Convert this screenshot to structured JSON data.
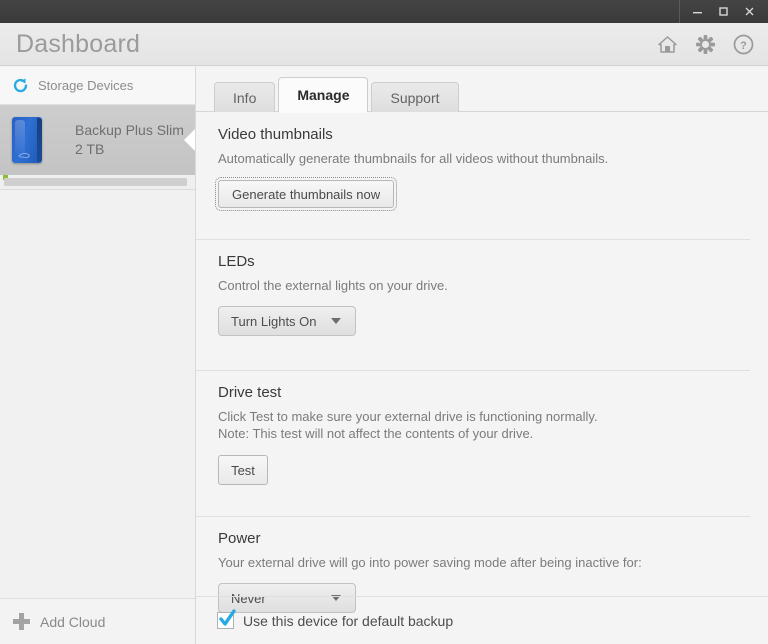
{
  "window": {
    "minimize_label": "minimize",
    "maximize_label": "maximize",
    "close_label": "close"
  },
  "header": {
    "title": "Dashboard",
    "icons": [
      {
        "name": "home-icon",
        "label": "Home"
      },
      {
        "name": "gear-icon",
        "label": "Settings"
      },
      {
        "name": "help-icon",
        "label": "Help"
      }
    ]
  },
  "sidebar": {
    "section_label": "Storage Devices",
    "device": {
      "name": "Backup Plus Slim",
      "capacity": "2 TB"
    },
    "add_cloud_label": "Add Cloud"
  },
  "tabs": [
    {
      "label": "Info",
      "active": false
    },
    {
      "label": "Manage",
      "active": true
    },
    {
      "label": "Support",
      "active": false
    }
  ],
  "sections": {
    "video_thumbnails": {
      "title": "Video thumbnails",
      "description": "Automatically generate thumbnails for all videos without thumbnails.",
      "button_label": "Generate thumbnails now"
    },
    "leds": {
      "title": "LEDs",
      "description": "Control the external lights on your drive.",
      "dropdown_value": "Turn Lights On"
    },
    "drive_test": {
      "title": "Drive test",
      "description_line1": "Click Test to make sure your external drive is functioning normally.",
      "description_line2": "Note: This test will not affect the contents of your drive.",
      "button_label": "Test"
    },
    "power": {
      "title": "Power",
      "description": "Your external drive will go into power saving mode after being inactive for:",
      "dropdown_value": "Never"
    }
  },
  "footer": {
    "default_backup_label": "Use this device for default backup",
    "default_backup_checked": true
  },
  "colors": {
    "accent_cyan": "#29abe2",
    "titlebar": "#3b3b3b",
    "header_bg": "#e9e9e9",
    "panel_bg": "#f4f4f4",
    "selected_item": "#c9c9c9",
    "drive_blue": "#2a62c4"
  }
}
